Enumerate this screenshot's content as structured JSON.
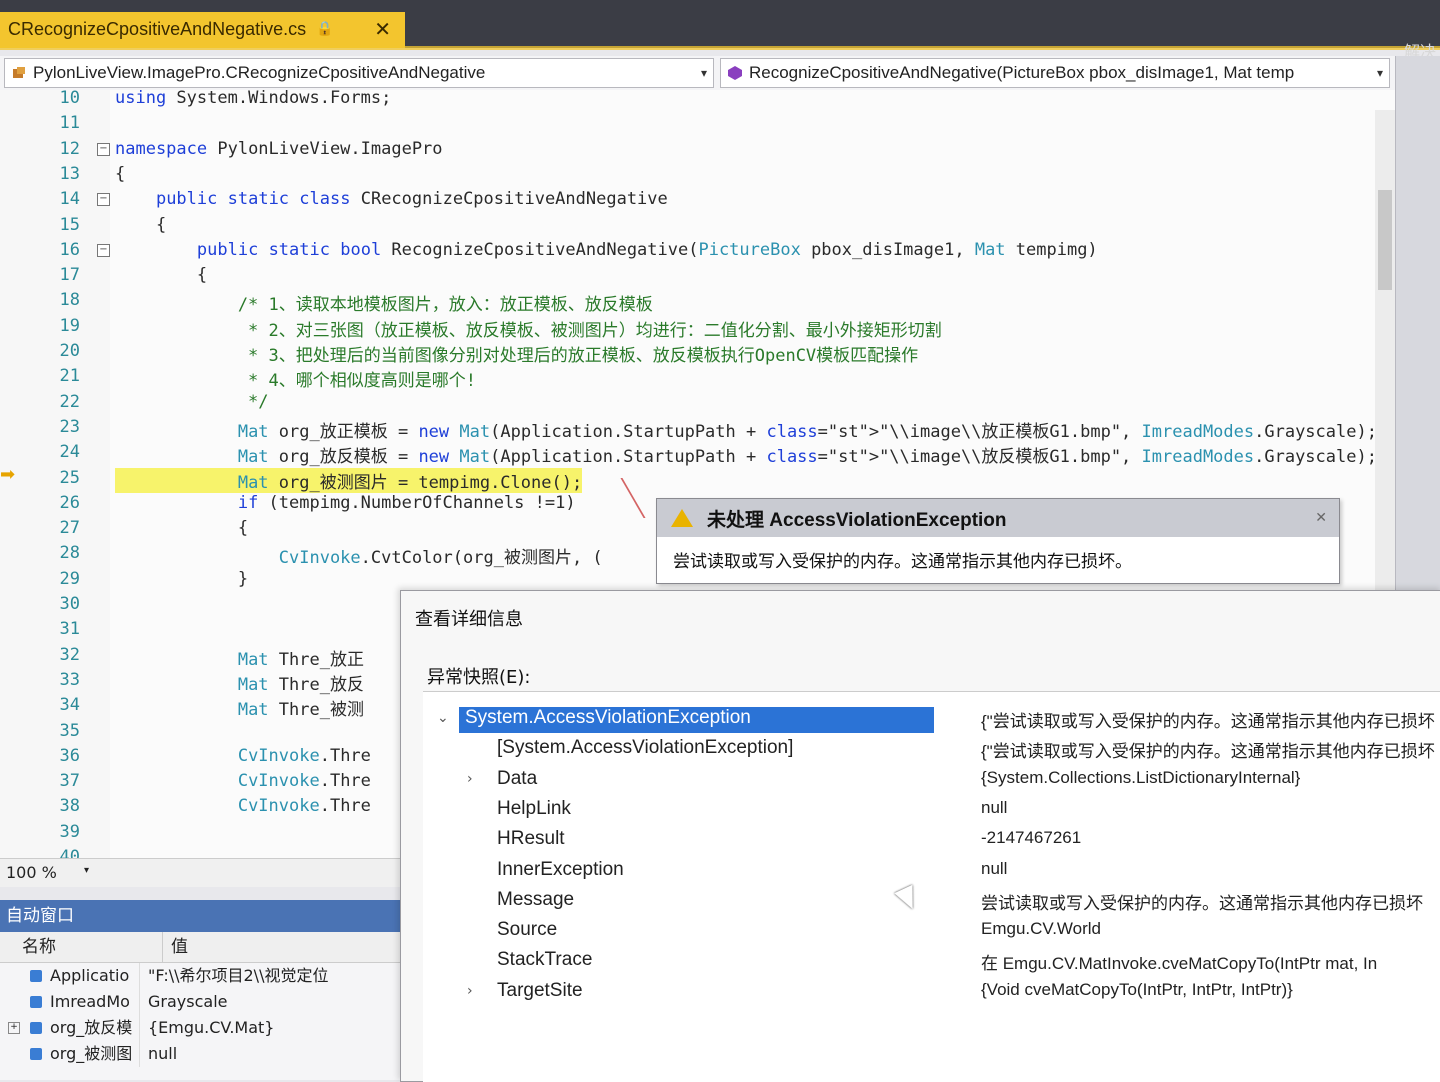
{
  "tab": {
    "title": "CRecognizeCpositiveAndNegative.cs",
    "lock_icon": "lock-icon",
    "close_glyph": "✕"
  },
  "side_label": "解决",
  "nav": {
    "class_path": "PylonLiveView.ImagePro.CRecognizeCpositiveAndNegative",
    "method_sig": "RecognizeCpositiveAndNegative(PictureBox pbox_disImage1, Mat temp"
  },
  "code_lines": [
    {
      "num": "10",
      "text": "using System.Windows.Forms;"
    },
    {
      "num": "11",
      "text": ""
    },
    {
      "num": "12",
      "text": "namespace PylonLiveView.ImagePro"
    },
    {
      "num": "13",
      "text": "{"
    },
    {
      "num": "14",
      "text": "    public static class CRecognizeCpositiveAndNegative"
    },
    {
      "num": "15",
      "text": "    {"
    },
    {
      "num": "16",
      "text": "        public static bool RecognizeCpositiveAndNegative(PictureBox pbox_disImage1, Mat tempimg)"
    },
    {
      "num": "17",
      "text": "        {"
    },
    {
      "num": "18",
      "text": "            /* 1、读取本地模板图片，放入：放正模板、放反模板"
    },
    {
      "num": "19",
      "text": "             * 2、对三张图（放正模板、放反模板、被测图片）均进行：二值化分割、最小外接矩形切割"
    },
    {
      "num": "20",
      "text": "             * 3、把处理后的当前图像分别对处理后的放正模板、放反模板执行OpenCV模板匹配操作"
    },
    {
      "num": "21",
      "text": "             * 4、哪个相似度高则是哪个!"
    },
    {
      "num": "22",
      "text": "             */"
    },
    {
      "num": "23",
      "text": "            Mat org_放正模板 = new Mat(Application.StartupPath + \"\\\\image\\\\放正模板G1.bmp\", ImreadModes.Grayscale);"
    },
    {
      "num": "24",
      "text": "            Mat org_放反模板 = new Mat(Application.StartupPath + \"\\\\image\\\\放反模板G1.bmp\", ImreadModes.Grayscale);"
    },
    {
      "num": "25",
      "text": "            Mat org_被测图片 = tempimg.Clone();"
    },
    {
      "num": "26",
      "text": "            if (tempimg.NumberOfChannels !=1)"
    },
    {
      "num": "27",
      "text": "            {"
    },
    {
      "num": "28",
      "text": "                CvInvoke.CvtColor(org_被测图片, ("
    },
    {
      "num": "29",
      "text": "            }"
    },
    {
      "num": "30",
      "text": ""
    },
    {
      "num": "31",
      "text": ""
    },
    {
      "num": "32",
      "text": "            Mat Thre_放正"
    },
    {
      "num": "33",
      "text": "            Mat Thre_放反"
    },
    {
      "num": "34",
      "text": "            Mat Thre_被测"
    },
    {
      "num": "35",
      "text": ""
    },
    {
      "num": "36",
      "text": "            CvInvoke.Thre"
    },
    {
      "num": "37",
      "text": "            CvInvoke.Thre"
    },
    {
      "num": "38",
      "text": "            CvInvoke.Thre"
    },
    {
      "num": "39",
      "text": ""
    },
    {
      "num": "40",
      "text": ""
    }
  ],
  "zoom": {
    "level": "100 %"
  },
  "exception_popup": {
    "title": "未处理 AccessViolationException",
    "message": "尝试读取或写入受保护的内存。这通常指示其他内存已损坏。"
  },
  "details": {
    "title": "查看详细信息",
    "snapshot_label": "异常快照(E):",
    "rows": [
      {
        "key": "System.AccessViolationException",
        "value": "{\"尝试读取或写入受保护的内存。这通常指示其他内存已损坏",
        "selected": true,
        "chevron": "⌄"
      },
      {
        "key": "[System.AccessViolationException]",
        "value": "{\"尝试读取或写入受保护的内存。这通常指示其他内存已损坏",
        "selected": false,
        "chevron": ""
      },
      {
        "key": "Data",
        "value": "{System.Collections.ListDictionaryInternal}",
        "selected": false,
        "chevron": "›"
      },
      {
        "key": "HelpLink",
        "value": "null",
        "selected": false,
        "chevron": ""
      },
      {
        "key": "HResult",
        "value": "-2147467261",
        "selected": false,
        "chevron": ""
      },
      {
        "key": "InnerException",
        "value": "null",
        "selected": false,
        "chevron": ""
      },
      {
        "key": "Message",
        "value": "尝试读取或写入受保护的内存。这通常指示其他内存已损坏",
        "selected": false,
        "chevron": ""
      },
      {
        "key": "Source",
        "value": "Emgu.CV.World",
        "selected": false,
        "chevron": ""
      },
      {
        "key": "StackTrace",
        "value": "  在 Emgu.CV.MatInvoke.cveMatCopyTo(IntPtr mat, In",
        "selected": false,
        "chevron": ""
      },
      {
        "key": "TargetSite",
        "value": "{Void cveMatCopyTo(IntPtr, IntPtr, IntPtr)}",
        "selected": false,
        "chevron": "›"
      }
    ]
  },
  "auto_window": {
    "title": "自动窗口",
    "col_name": "名称",
    "col_value": "值",
    "rows": [
      {
        "name": "Applicatio",
        "value": "\"F:\\\\希尔项目2\\\\视觉定位"
      },
      {
        "name": "ImreadMo",
        "value": "Grayscale"
      },
      {
        "name": "org_放反模",
        "value": "{Emgu.CV.Mat}"
      },
      {
        "name": "org_被测图",
        "value": "null"
      }
    ]
  },
  "colors": {
    "tab_active": "#f3c52e",
    "selection": "#2b73d6",
    "keyword": "#1e3fd8",
    "type": "#2b91af",
    "comment": "#2a7a2a",
    "highlight": "#f7f36b"
  }
}
